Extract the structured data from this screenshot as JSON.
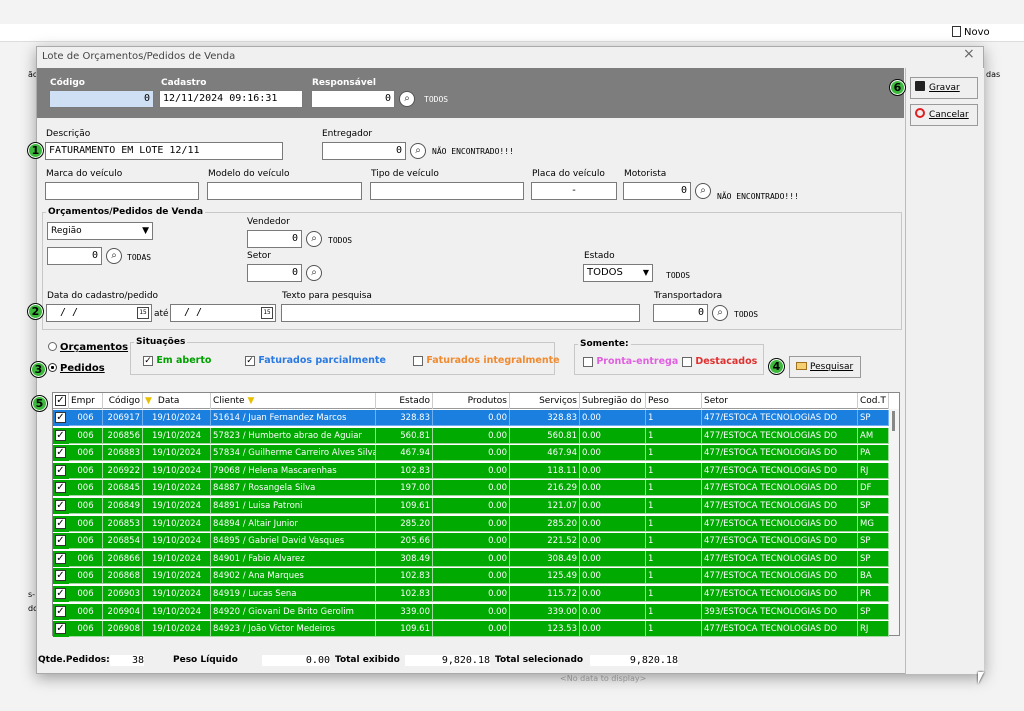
{
  "background": {
    "novo_label": "Novo",
    "left_frag_1": "ão",
    "right_frag": "das",
    "left_frag_2": "s-",
    "left_frag_3": "do",
    "no_data": "<No data to display>"
  },
  "window": {
    "title": "Lote de Orçamentos/Pedidos de Venda",
    "close": "×"
  },
  "header": {
    "codigo_label": "Código",
    "codigo_value": "0",
    "cadastro_label": "Cadastro",
    "cadastro_value": "12/11/2024 09:16:31",
    "responsavel_label": "Responsável",
    "responsavel_value": "0",
    "responsavel_status": "TODOS"
  },
  "form": {
    "descricao_label": "Descrição",
    "descricao_value": "FATURAMENTO EM LOTE 12/11",
    "entregador_label": "Entregador",
    "entregador_value": "0",
    "entregador_status": "NÃO ENCONTRADO!!!",
    "marca_label": "Marca do veículo",
    "modelo_label": "Modelo do veículo",
    "tipo_label": "Tipo de veículo",
    "placa_label": "Placa do veículo",
    "placa_value": "-",
    "motorista_label": "Motorista",
    "motorista_value": "0",
    "motorista_status": "NÃO ENCONTRADO!!!",
    "group_title": "Orçamentos/Pedidos de Venda",
    "regiao_value": "Região",
    "regiao_num": "0",
    "regiao_status": "TODAS",
    "vendedor_label": "Vendedor",
    "vendedor_value": "0",
    "vendedor_status": "TODOS",
    "setor_label": "Setor",
    "setor_value": "0",
    "estado_label": "Estado",
    "estado_value": "TODOS",
    "estado_status": "TODOS",
    "data_label": "Data do cadastro/pedido",
    "data_from": "/  /",
    "ate": "até",
    "data_to": "/  /",
    "texto_label": "Texto para pesquisa",
    "transp_label": "Transportadora",
    "transp_value": "0",
    "transp_status": "TODOS"
  },
  "filters": {
    "orcamentos": "Orçamentos",
    "pedidos": "Pedidos",
    "situacoes_title": "Situações",
    "em_aberto": "Em aberto",
    "fat_parc": "Faturados parcialmente",
    "fat_int": "Faturados integralmente",
    "somente_title": "Somente:",
    "pronta": "Pronta-entrega",
    "destacados": "Destacados",
    "pesquisar": "Pesquisar"
  },
  "colors": {
    "green": "#00aa00",
    "selected": "#1a7fdf",
    "em_aberto": "#00a000",
    "fat_parc": "#2a7ae2",
    "fat_int": "#f08a30",
    "pronta": "#e060e0",
    "destacados": "#e03030",
    "badge": "#3cb83c"
  },
  "actions": {
    "gravar": "Gravar",
    "cancelar": "Cancelar"
  },
  "badges": [
    "1",
    "2",
    "3",
    "4",
    "5",
    "6"
  ],
  "grid": {
    "headers": [
      "Empr",
      "Código",
      "Data",
      "Cliente",
      "Estado",
      "Produtos",
      "Serviços",
      "Subregião do",
      "Peso",
      "Setor",
      "Cod.T"
    ],
    "rows": [
      [
        "006",
        "206917",
        "19/10/2024",
        "51614 / Juan Fernandez Marcos",
        "328.83",
        "0.00",
        "328.83",
        "0.00",
        "1",
        "477/ESTOCA TECNOLOGIAS DO",
        "SP"
      ],
      [
        "006",
        "206856",
        "19/10/2024",
        "57823 / Humberto abrao de Aguiar",
        "560.81",
        "0.00",
        "560.81",
        "0.00",
        "1",
        "477/ESTOCA TECNOLOGIAS DO",
        "AM"
      ],
      [
        "006",
        "206883",
        "19/10/2024",
        "57834 / Guilherme Carreiro Alves Silva",
        "467.94",
        "0.00",
        "467.94",
        "0.00",
        "1",
        "477/ESTOCA TECNOLOGIAS DO",
        "PA"
      ],
      [
        "006",
        "206922",
        "19/10/2024",
        "79068 / Helena  Mascarenhas",
        "102.83",
        "0.00",
        "118.11",
        "0.00",
        "1",
        "477/ESTOCA TECNOLOGIAS DO",
        "RJ"
      ],
      [
        "006",
        "206845",
        "19/10/2024",
        "84887 / Rosangela Silva",
        "197.00",
        "0.00",
        "216.29",
        "0.00",
        "1",
        "477/ESTOCA TECNOLOGIAS DO",
        "DF"
      ],
      [
        "006",
        "206849",
        "19/10/2024",
        "84891 / Luisa Patroni",
        "109.61",
        "0.00",
        "121.07",
        "0.00",
        "1",
        "477/ESTOCA TECNOLOGIAS DO",
        "SP"
      ],
      [
        "006",
        "206853",
        "19/10/2024",
        "84894 / Altair Junior",
        "285.20",
        "0.00",
        "285.20",
        "0.00",
        "1",
        "477/ESTOCA TECNOLOGIAS DO",
        "MG"
      ],
      [
        "006",
        "206854",
        "19/10/2024",
        "84895 / Gabriel David Vasques",
        "205.66",
        "0.00",
        "221.52",
        "0.00",
        "1",
        "477/ESTOCA TECNOLOGIAS DO",
        "SP"
      ],
      [
        "006",
        "206866",
        "19/10/2024",
        "84901 / Fabio Alvarez",
        "308.49",
        "0.00",
        "308.49",
        "0.00",
        "1",
        "477/ESTOCA TECNOLOGIAS DO",
        "SP"
      ],
      [
        "006",
        "206868",
        "19/10/2024",
        "84902 / Ana Marques",
        "102.83",
        "0.00",
        "125.49",
        "0.00",
        "1",
        "477/ESTOCA TECNOLOGIAS DO",
        "BA"
      ],
      [
        "006",
        "206903",
        "19/10/2024",
        "84919 / Lucas Sena",
        "102.83",
        "0.00",
        "115.72",
        "0.00",
        "1",
        "477/ESTOCA TECNOLOGIAS DO",
        "PR"
      ],
      [
        "006",
        "206904",
        "19/10/2024",
        "84920 / Giovani De Brito Gerolim",
        "339.00",
        "0.00",
        "339.00",
        "0.00",
        "1",
        "393/ESTOCA TECNOLOGIAS DO",
        "SP"
      ],
      [
        "006",
        "206908",
        "19/10/2024",
        "84923 / João Victor Medeiros",
        "109.61",
        "0.00",
        "123.53",
        "0.00",
        "1",
        "477/ESTOCA TECNOLOGIAS DO",
        "RJ"
      ]
    ]
  },
  "footer": {
    "qtde_label": "Qtde.Pedidos:",
    "qtde_value": "38",
    "peso_label": "Peso Líquido",
    "peso_value": "0.00",
    "total_exib_label": "Total exibido",
    "total_exib_value": "9,820.18",
    "total_sel_label": "Total selecionado",
    "total_sel_value": "9,820.18"
  }
}
